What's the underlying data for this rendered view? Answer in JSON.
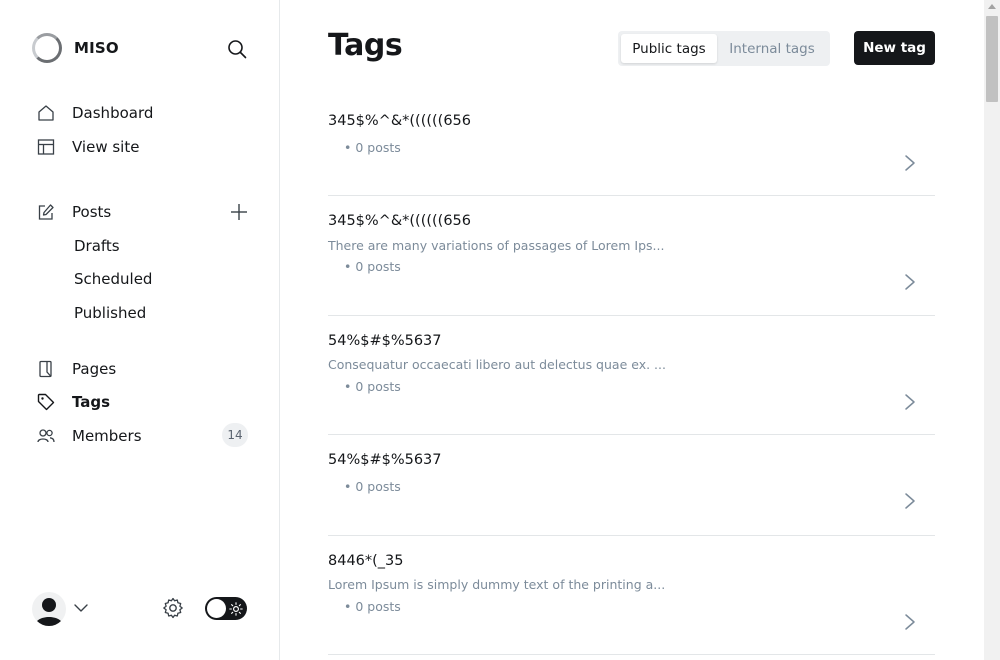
{
  "app": {
    "brand_name": "MISO"
  },
  "sidebar": {
    "nav": [
      {
        "label": "Dashboard",
        "icon": "home-icon"
      },
      {
        "label": "View site",
        "icon": "layout-icon"
      }
    ],
    "posts": {
      "label": "Posts",
      "icon": "edit-icon",
      "sub": [
        "Drafts",
        "Scheduled",
        "Published"
      ]
    },
    "pages_label": "Pages",
    "tags_label": "Tags",
    "members_label": "Members",
    "members_count": "14"
  },
  "header": {
    "title": "Tags",
    "public_tags_label": "Public tags",
    "internal_tags_label": "Internal tags",
    "new_tag_label": "New tag"
  },
  "tags": [
    {
      "name": "345$%^&*((((((656",
      "description": "",
      "count": "• 0 posts"
    },
    {
      "name": "345$%^&*((((((656",
      "description": "There are many variations of passages of Lorem Ips...",
      "count": "• 0 posts"
    },
    {
      "name": "54%$#$%5637",
      "description": "Consequatur occaecati libero aut delectus quae ex. ...",
      "count": "• 0 posts"
    },
    {
      "name": "54%$#$%5637",
      "description": "",
      "count": "• 0 posts"
    },
    {
      "name": "8446*(_35",
      "description": "Lorem Ipsum is simply dummy text of the printing a...",
      "count": "• 0 posts"
    }
  ],
  "colors": {
    "accent_dark": "#15171a",
    "muted_text": "#7c8b9a",
    "divider": "#e3e6e8"
  }
}
